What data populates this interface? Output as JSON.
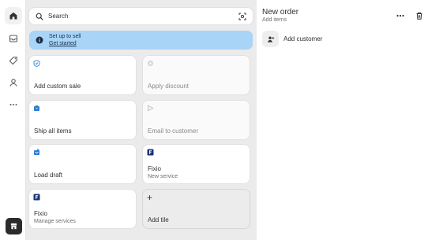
{
  "nav": {
    "items": [
      {
        "name": "home",
        "icon": "home-icon",
        "active": true
      },
      {
        "name": "orders",
        "icon": "inbox-icon"
      },
      {
        "name": "products",
        "icon": "tag-icon"
      },
      {
        "name": "customers",
        "icon": "person-icon"
      },
      {
        "name": "more",
        "icon": "more-horizontal-icon"
      }
    ],
    "store_icon": "store-icon"
  },
  "search": {
    "placeholder": "Search"
  },
  "banner": {
    "title": "Set up to sell",
    "link": "Get started",
    "color": "#a8d4f8"
  },
  "tiles": [
    {
      "label": "Add custom sale",
      "icon": "shield-check-icon",
      "disabled": false
    },
    {
      "label": "Apply discount",
      "icon": "discount-icon",
      "disabled": true
    },
    {
      "label": "Ship all items",
      "icon": "ship-box-icon",
      "disabled": false
    },
    {
      "label": "Email to customer",
      "icon": "send-icon",
      "disabled": true
    },
    {
      "label": "Load draft",
      "icon": "draft-icon",
      "disabled": false
    },
    {
      "label": "Fixio",
      "sub": "New service",
      "icon": "fixio-app-icon",
      "disabled": false
    },
    {
      "label": "Fixio",
      "sub": "Manage services",
      "icon": "fixio-app-icon",
      "disabled": false
    },
    {
      "label": "Add tile",
      "icon": "plus-icon",
      "disabled": false
    }
  ],
  "order": {
    "title": "New order",
    "subtitle": "Add items",
    "add_customer": "Add customer"
  }
}
